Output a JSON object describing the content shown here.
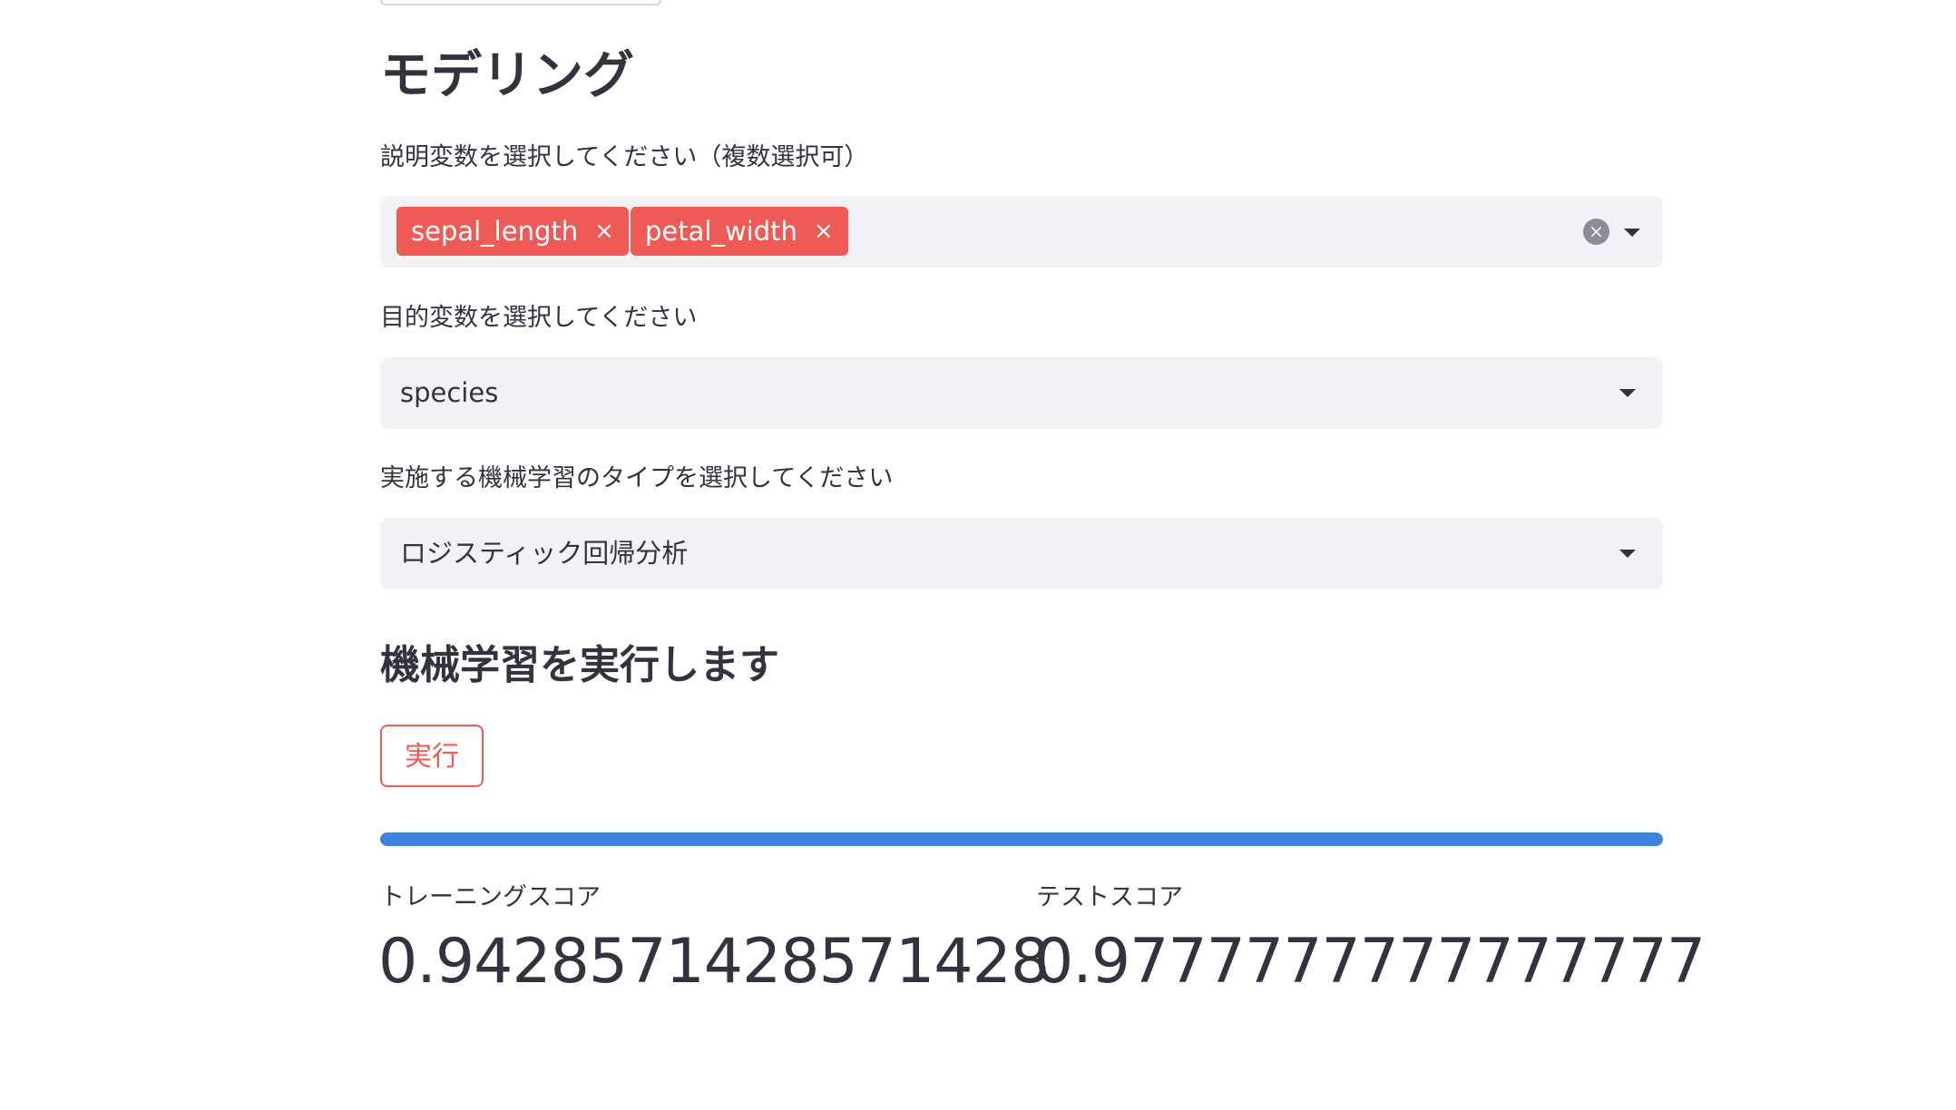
{
  "page": {
    "heading": "モデリング",
    "features": {
      "label": "説明変数を選択してください（複数選択可）",
      "selected": [
        "sepal_length",
        "petal_width"
      ],
      "remove_glyph": "×",
      "clear_glyph": "×"
    },
    "target": {
      "label": "目的変数を選択してください",
      "value": "species"
    },
    "ml_type": {
      "label": "実施する機械学習のタイプを選択してください",
      "value": "ロジスティック回帰分析"
    },
    "run_heading": "機械学習を実行します",
    "run_button": "実行",
    "progress": 100,
    "metrics": [
      {
        "label": "トレーニングスコア",
        "value": "0.9428571428571428"
      },
      {
        "label": "テストスコア",
        "value": "0.9777777777777777"
      }
    ]
  },
  "colors": {
    "accent": "#ee5a55",
    "progress": "#3f82d9",
    "input_bg": "#f0f2f6",
    "text": "#31333f"
  }
}
